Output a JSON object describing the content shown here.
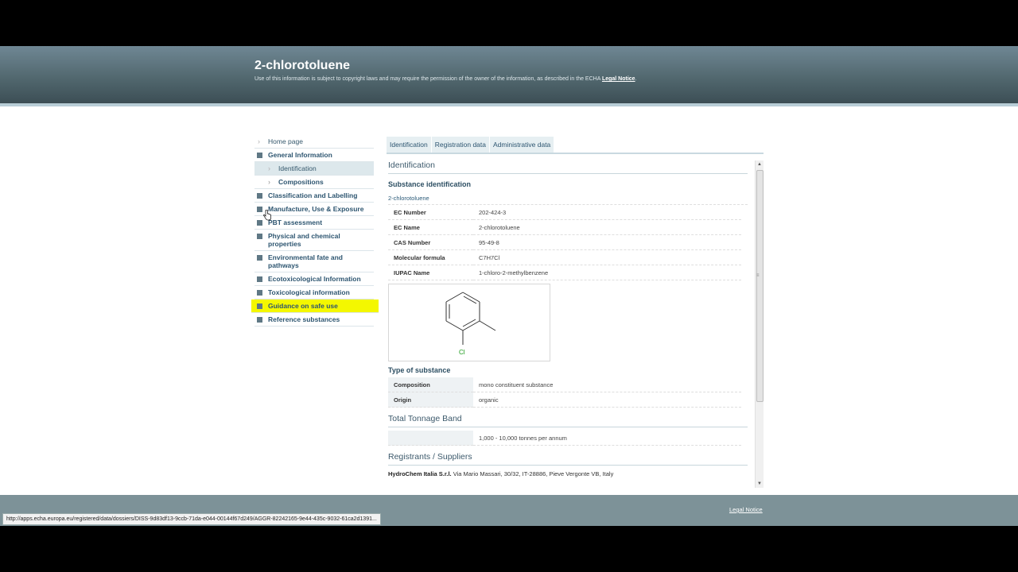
{
  "header": {
    "title": "2-chlorotoluene",
    "notice_text": "Use of this information is subject to copyright laws and may require the permission of the owner of the information, as described in the ECHA",
    "notice_link": "Legal Notice",
    "notice_end": "."
  },
  "sidebar": {
    "items": [
      {
        "label": "Home page"
      },
      {
        "label": "General Information"
      },
      {
        "label": "Identification"
      },
      {
        "label": "Compositions"
      },
      {
        "label": "Classification and Labelling"
      },
      {
        "label": "Manufacture, Use & Exposure"
      },
      {
        "label": "PBT assessment"
      },
      {
        "label": "Physical and chemical properties"
      },
      {
        "label": "Environmental fate and pathways"
      },
      {
        "label": "Ecotoxicological Information"
      },
      {
        "label": "Toxicological information"
      },
      {
        "label": "Guidance on safe use"
      },
      {
        "label": "Reference substances"
      }
    ]
  },
  "tabs": [
    "Identification",
    "Registration data",
    "Administrative data"
  ],
  "main": {
    "section_title": "Identification",
    "substance_id_heading": "Substance identification",
    "substance_name": "2-chlorotoluene",
    "identifiers": [
      {
        "key": "EC Number",
        "value": "202-424-3"
      },
      {
        "key": "EC Name",
        "value": "2-chlorotoluene"
      },
      {
        "key": "CAS Number",
        "value": "95-49-8"
      },
      {
        "key": "Molecular formula",
        "value": "C7H7Cl"
      },
      {
        "key": "IUPAC Name",
        "value": "1-chloro-2-methylbenzene"
      }
    ],
    "structure_label": "Cl",
    "type_heading": "Type of substance",
    "type_rows": [
      {
        "key": "Composition",
        "value": "mono constituent substance"
      },
      {
        "key": "Origin",
        "value": "organic"
      }
    ],
    "tonnage_title": "Total Tonnage Band",
    "tonnage_value": "1,000 - 10,000 tonnes per annum",
    "registrants_title": "Registrants / Suppliers",
    "registrant_name": "HydroChem Italia S.r.l.",
    "registrant_address": "Via Mario Massari, 30/32, IT-28886, Pieve Vergonte VB, Italy"
  },
  "footer": {
    "legal_link": "Legal Notice"
  },
  "statusbar": {
    "url": "http://apps.echa.europa.eu/registered/data/dossiers/DISS-9d83df13-9ccb-71da-e044-00144f67d249/AGGR-82242165-9e44-435c-9032-61ca2d1391..."
  },
  "colors": {
    "header": "#52686f",
    "highlight": "#f4f700",
    "link": "#2d5570"
  }
}
